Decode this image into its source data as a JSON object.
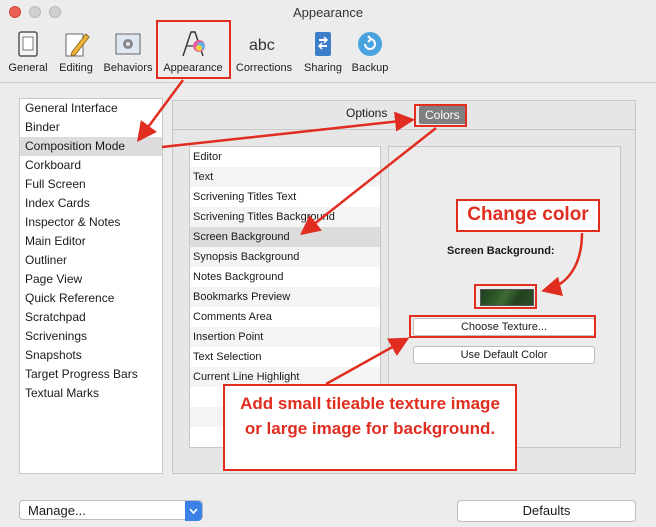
{
  "window": {
    "title": "Appearance"
  },
  "toolbar": {
    "items": [
      {
        "label": "General",
        "icon": "general-icon"
      },
      {
        "label": "Editing",
        "icon": "pencil-icon"
      },
      {
        "label": "Behaviors",
        "icon": "gear-window-icon"
      },
      {
        "label": "Appearance",
        "icon": "appearance-icon",
        "selected": true
      },
      {
        "label": "Corrections",
        "icon": "abc-icon"
      },
      {
        "label": "Sharing",
        "icon": "sharing-icon"
      },
      {
        "label": "Backup",
        "icon": "backup-icon"
      }
    ]
  },
  "sidebar": {
    "items": [
      "General Interface",
      "Binder",
      "Composition Mode",
      "Corkboard",
      "Full Screen",
      "Index Cards",
      "Inspector & Notes",
      "Main Editor",
      "Outliner",
      "Page View",
      "Quick Reference",
      "Scratchpad",
      "Scrivenings",
      "Snapshots",
      "Target Progress Bars",
      "Textual Marks"
    ],
    "selected": "Composition Mode"
  },
  "tabs": {
    "options": "Options",
    "colors": "Colors",
    "selected": "Colors"
  },
  "color_list": {
    "items": [
      "Editor",
      "Text",
      "Scrivening Titles Text",
      "Scrivening Titles Background",
      "Screen Background",
      "Synopsis Background",
      "Notes Background",
      "Bookmarks Preview",
      "Comments Area",
      "Insertion Point",
      "Text Selection",
      "Current Line Highlight"
    ],
    "selected": "Screen Background"
  },
  "preview": {
    "label": "Screen Background:",
    "choose_texture": "Choose Texture...",
    "use_default": "Use Default Color"
  },
  "annotations": {
    "change_color": "Change color",
    "texture_note": "Add small tileable texture image or large image for background."
  },
  "footer": {
    "manage": "Manage...",
    "defaults": "Defaults"
  },
  "colors": {
    "annotation": "#e02d20",
    "popup_accent": "#3b82e8"
  }
}
